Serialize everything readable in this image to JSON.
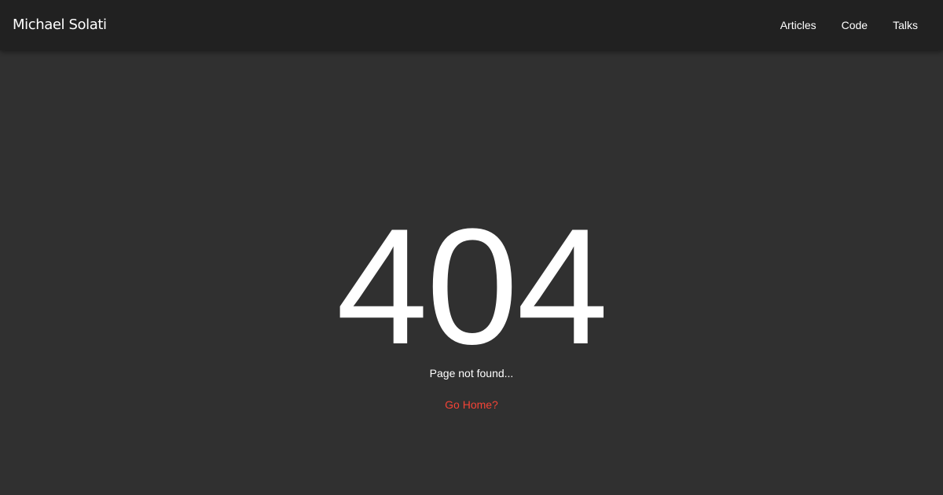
{
  "header": {
    "brand": "Michael Solati",
    "nav": [
      {
        "label": "Articles"
      },
      {
        "label": "Code"
      },
      {
        "label": "Talks"
      }
    ]
  },
  "main": {
    "error_code": "404",
    "message": "Page not found...",
    "home_link": "Go Home?"
  },
  "colors": {
    "header_background": "#212121",
    "page_background": "#303030",
    "text": "#ffffff",
    "accent": "#f44336"
  }
}
